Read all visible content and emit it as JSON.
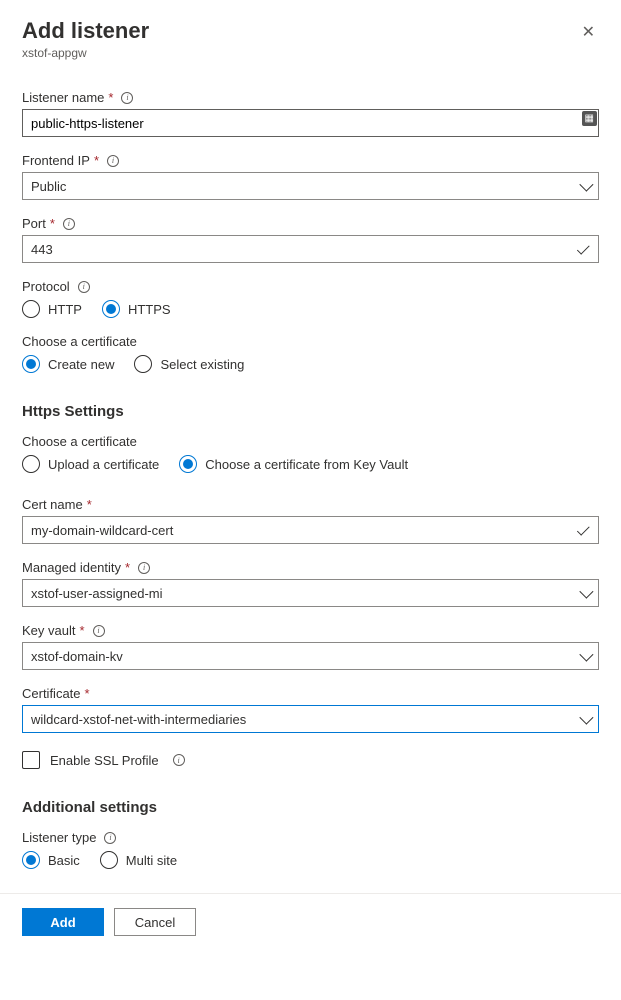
{
  "header": {
    "title": "Add listener",
    "subtitle": "xstof-appgw"
  },
  "fields": {
    "listener_name": {
      "label": "Listener name",
      "value": "public-https-listener"
    },
    "frontend_ip": {
      "label": "Frontend IP",
      "value": "Public"
    },
    "port": {
      "label": "Port",
      "value": "443"
    },
    "protocol": {
      "label": "Protocol",
      "opts": {
        "http": "HTTP",
        "https": "HTTPS"
      },
      "selected": "https"
    },
    "choose_cert": {
      "label": "Choose a certificate",
      "opts": {
        "new": "Create new",
        "existing": "Select existing"
      },
      "selected": "new"
    },
    "https_section": {
      "title": "Https Settings"
    },
    "choose_cert2": {
      "label": "Choose a certificate",
      "opts": {
        "upload": "Upload a certificate",
        "kv": "Choose a certificate from Key Vault"
      },
      "selected": "kv"
    },
    "cert_name": {
      "label": "Cert name",
      "value": "my-domain-wildcard-cert"
    },
    "managed_id": {
      "label": "Managed identity",
      "value": "xstof-user-assigned-mi"
    },
    "key_vault": {
      "label": "Key vault",
      "value": "xstof-domain-kv"
    },
    "certificate": {
      "label": "Certificate",
      "value": "wildcard-xstof-net-with-intermediaries"
    },
    "ssl_profile": {
      "label": "Enable SSL Profile"
    },
    "additional": {
      "title": "Additional settings"
    },
    "listener_type": {
      "label": "Listener type",
      "opts": {
        "basic": "Basic",
        "multi": "Multi site"
      },
      "selected": "basic"
    }
  },
  "footer": {
    "add": "Add",
    "cancel": "Cancel"
  }
}
